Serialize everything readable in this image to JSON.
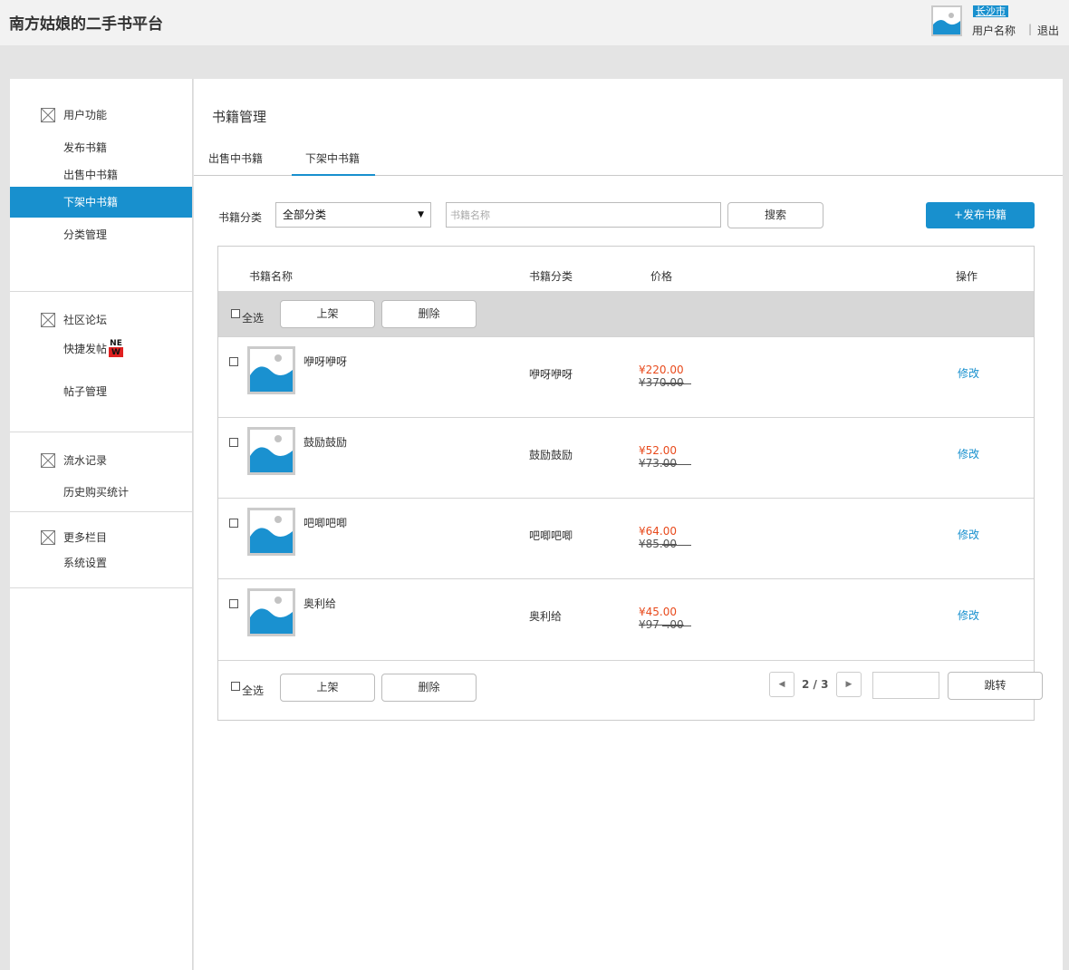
{
  "header": {
    "app_title": "南方姑娘的二手书平台",
    "city": "长沙市",
    "user_name": "用户名称",
    "separator": "|",
    "logout": "退出"
  },
  "sidebar": {
    "sections": [
      {
        "title": "用户功能",
        "items": [
          "发布书籍",
          "出售中书籍",
          "下架中书籍",
          "分类管理"
        ]
      },
      {
        "title": "社区论坛",
        "items": [
          "快捷发帖",
          "帖子管理"
        ],
        "new_badge": "NEW"
      },
      {
        "title": "流水记录",
        "items": [
          "历史购买统计"
        ]
      },
      {
        "title": "更多栏目",
        "items": [
          "系统设置"
        ]
      }
    ],
    "active_item": "下架中书籍"
  },
  "main": {
    "page_title": "书籍管理",
    "tabs": [
      {
        "label": "出售中书籍",
        "active": false
      },
      {
        "label": "下架中书籍",
        "active": true
      }
    ],
    "filter": {
      "category_label": "书籍分类",
      "category_value": "全部分类",
      "search_placeholder": "书籍名称",
      "search_button": "搜索",
      "publish_button": "+发布书籍"
    },
    "table": {
      "headers": [
        "书籍名称",
        "书籍分类",
        "价格",
        "操作"
      ],
      "select_all": "全选",
      "shelve_button": "上架",
      "delete_button": "删除",
      "rows": [
        {
          "name": "咿呀咿呀",
          "category": "咿呀咿呀",
          "price": "¥220.00",
          "original_price": "¥370.00",
          "action": "修改"
        },
        {
          "name": "鼓励鼓励",
          "category": "鼓励鼓励",
          "price": "¥52.00",
          "original_price": "¥73.00",
          "action": "修改"
        },
        {
          "name": "吧唧吧唧",
          "category": "吧唧吧唧",
          "price": "¥64.00",
          "original_price": "¥85.00",
          "action": "修改"
        },
        {
          "name": "奥利给",
          "category": "奥利给",
          "price": "¥45.00",
          "original_price": "¥97  .00",
          "action": "修改"
        }
      ]
    },
    "pagination": {
      "prev_icon": "caret-left-icon",
      "next_icon": "caret-right-icon",
      "current_page": 2,
      "total_pages": 3,
      "page_text": "2 / 3",
      "jump_button": "跳转"
    }
  },
  "colors": {
    "accent": "#1890ce",
    "price_red": "#e84a1c",
    "frame_gray": "#e4e4e4",
    "action_bar_gray": "#d7d7d7"
  }
}
